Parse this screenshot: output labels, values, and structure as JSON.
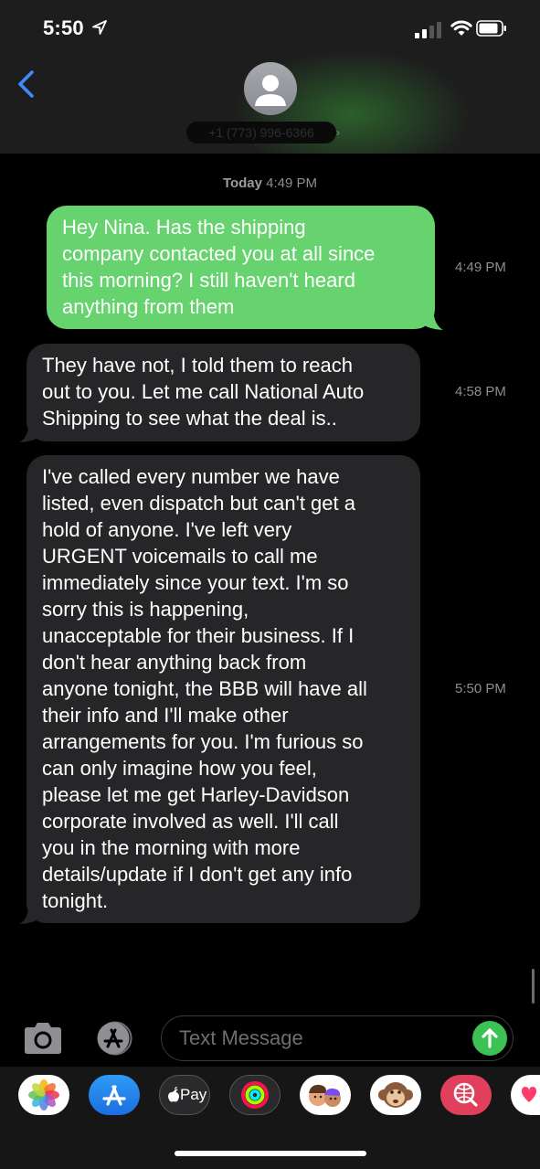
{
  "status_bar": {
    "time": "5:50"
  },
  "header": {
    "contact": "+1 (773) 996-6366"
  },
  "conversation": {
    "date_label": "Today",
    "date_time": "4:49 PM",
    "messages": [
      {
        "direction": "sent",
        "time": "4:49 PM",
        "lines": [
          "Hey Nina. Has the shipping",
          "company contacted you at all since",
          "this morning? I still haven't heard",
          "anything from them"
        ]
      },
      {
        "direction": "received",
        "time": "4:58 PM",
        "lines": [
          "They have not, I told them to reach",
          "out to you. Let me call National Auto",
          "Shipping to see what the deal is.."
        ]
      },
      {
        "direction": "received",
        "time": "5:50 PM",
        "lines": [
          "I've called every number we have",
          "listed, even dispatch but can't get a",
          "hold of anyone. I've left very",
          "URGENT voicemails to call me",
          "immediately since your text. I'm so",
          "sorry this is happening,",
          "unacceptable for their business. If I",
          "don't hear anything back from",
          "anyone tonight, the BBB will have all",
          "their info and I'll make other",
          "arrangements for you. I'm furious so",
          "can only imagine how you feel,",
          "please let me get Harley-Davidson",
          "corporate involved as well. I'll call",
          "you in the morning with more",
          "details/update if I don't get any info",
          "tonight."
        ]
      }
    ]
  },
  "composer": {
    "placeholder": "Text Message"
  },
  "app_drawer": {
    "apps": [
      "photos-app",
      "app-store-app",
      "apple-pay-app",
      "activity-app",
      "memoji-app",
      "animoji-app",
      "image-search-app",
      "digital-touch-app"
    ],
    "apple_pay_label": "Pay"
  },
  "colors": {
    "sent_bubble": "#66d36e",
    "received_bubble": "#262628",
    "accent": "#3f8cff"
  }
}
